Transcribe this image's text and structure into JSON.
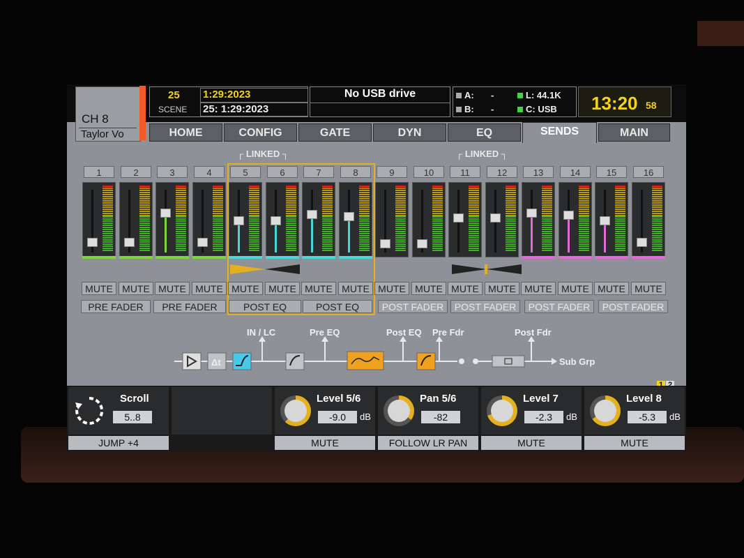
{
  "channel": {
    "number": "CH 8",
    "name": "Taylor Vo"
  },
  "scene": {
    "number": "25",
    "label": "SCENE",
    "name_top": "1:29:2023",
    "name_bottom": "25: 1:29:2023"
  },
  "usb": {
    "status": "No USB drive"
  },
  "status": {
    "a_label": "A:",
    "a_value": "-",
    "b_label": "B:",
    "b_value": "-",
    "l_label": "L:",
    "l_value": "44.1K",
    "c_label": "C:",
    "c_value": "USB"
  },
  "clock": {
    "time": "13:20",
    "seconds": "58"
  },
  "tabs": [
    {
      "label": "HOME"
    },
    {
      "label": "CONFIG"
    },
    {
      "label": "GATE"
    },
    {
      "label": "DYN"
    },
    {
      "label": "EQ"
    },
    {
      "label": "SENDS"
    },
    {
      "label": "MAIN"
    }
  ],
  "linked_labels": [
    "LINKED",
    "LINKED"
  ],
  "channels": [
    {
      "num": "1",
      "level": 0.18,
      "color": "#7cd63a",
      "mute": "MUTE"
    },
    {
      "num": "2",
      "level": 0.18,
      "color": "#7cd63a",
      "mute": "MUTE"
    },
    {
      "num": "3",
      "level": 0.68,
      "color": "#7cd63a",
      "mute": "MUTE"
    },
    {
      "num": "4",
      "level": 0.18,
      "color": "#7cd63a",
      "mute": "MUTE"
    },
    {
      "num": "5",
      "level": 0.55,
      "color": "#48d6d6",
      "mute": "MUTE"
    },
    {
      "num": "6",
      "level": 0.55,
      "color": "#48d6d6",
      "mute": "MUTE"
    },
    {
      "num": "7",
      "level": 0.66,
      "color": "#48d6d6",
      "mute": "MUTE"
    },
    {
      "num": "8",
      "level": 0.62,
      "color": "#48d6d6",
      "mute": "MUTE"
    },
    {
      "num": "9",
      "level": 0.16,
      "color": "#2b2c2e",
      "mute": "MUTE"
    },
    {
      "num": "10",
      "level": 0.16,
      "color": "#2b2c2e",
      "mute": "MUTE"
    },
    {
      "num": "11",
      "level": 0.6,
      "color": "#2b2c2e",
      "mute": "MUTE"
    },
    {
      "num": "12",
      "level": 0.6,
      "color": "#2b2c2e",
      "mute": "MUTE"
    },
    {
      "num": "13",
      "level": 0.68,
      "color": "#e36ad6",
      "mute": "MUTE"
    },
    {
      "num": "14",
      "level": 0.64,
      "color": "#e36ad6",
      "mute": "MUTE"
    },
    {
      "num": "15",
      "level": 0.55,
      "color": "#e36ad6",
      "mute": "MUTE"
    },
    {
      "num": "16",
      "level": 0.18,
      "color": "#e36ad6",
      "mute": "MUTE"
    }
  ],
  "send_points": [
    "PRE FADER",
    "PRE FADER",
    "POST EQ",
    "POST EQ",
    "POST FADER",
    "POST FADER",
    "POST FADER",
    "POST FADER"
  ],
  "flow": {
    "in_lc": "IN / LC",
    "pre_eq": "Pre EQ",
    "post_eq": "Post EQ",
    "pre_fdr": "Pre Fdr",
    "post_fdr": "Post Fdr",
    "sub_grp": "Sub Grp",
    "delay": "Δt"
  },
  "controls": {
    "scroll": {
      "title": "Scroll",
      "value": "5..8",
      "button": "JUMP +4"
    },
    "level56": {
      "title": "Level 5/6",
      "value": "-9.0",
      "unit": "dB",
      "button": "MUTE",
      "knob": 0.62
    },
    "pan56": {
      "title": "Pan 5/6",
      "value": "-82",
      "button": "FOLLOW LR PAN",
      "knob": 0.35
    },
    "level7": {
      "title": "Level 7",
      "value": "-2.3",
      "unit": "dB",
      "button": "MUTE",
      "knob": 0.7
    },
    "level8": {
      "title": "Level 8",
      "value": "-5.3",
      "unit": "dB",
      "button": "MUTE",
      "knob": 0.66
    }
  },
  "pages": [
    "1",
    "2"
  ],
  "colors": {
    "accent": "#e5b01e",
    "orange": "#f05a24",
    "cyan": "#48d6d6",
    "green": "#7cd63a",
    "pink": "#e36ad6"
  }
}
